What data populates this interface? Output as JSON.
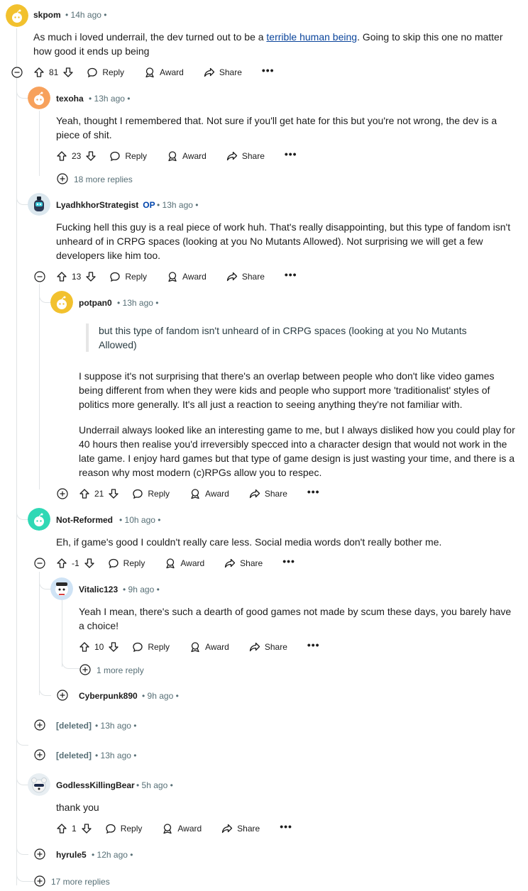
{
  "comments": [
    {
      "user": "skpom",
      "meta": "• 14h ago •",
      "text_before": "As much i loved underrail, the dev turned out to be a ",
      "link": "terrible human being",
      "text_after": ". Going to skip this one no matter how good it ends up being",
      "votes": "81"
    },
    {
      "user": "texoha",
      "meta": "• 13h ago •",
      "text": "Yeah, thought I remembered that. Not sure if you'll get hate for this but you're not wrong, the dev is a piece of shit.",
      "votes": "23",
      "more": "18 more replies"
    },
    {
      "user": "LyadhkhorStrategist",
      "op": "OP",
      "meta": "• 13h ago •",
      "text": "Fucking hell this guy is a real piece of work huh. That's really disappointing, but this type of fandom isn't unheard of in CRPG spaces (looking at you No Mutants Allowed). Not surprising we will get a few developers like him too.",
      "votes": "13"
    },
    {
      "user": "potpan0",
      "meta": "• 13h ago •",
      "quote": "but this type of fandom isn't unheard of in CRPG spaces (looking at you No Mutants Allowed)",
      "p1": "I suppose it's not surprising that there's an overlap between people who don't like video games being different from when they were kids and people who support more 'traditionalist' styles of politics more generally. It's all just a reaction to seeing anything they're not familiar with.",
      "p2": "Underrail always looked like an interesting game to me, but I always disliked how you could play for 40 hours then realise you'd irreversibly specced into a character design that would not work in the late game. I enjoy hard games but that type of game design is just wasting your time, and there is a reason why most modern (c)RPGs allow you to respec.",
      "votes": "21"
    },
    {
      "user": "Not-Reformed",
      "meta": "• 10h ago •",
      "text": "Eh, if game's good I couldn't really care less. Social media words don't really bother me.",
      "votes": "-1"
    },
    {
      "user": "Vitalic123",
      "meta": "• 9h ago •",
      "text": "Yeah I mean, there's such a dearth of good games not made by scum these days, you barely have a choice!",
      "votes": "10",
      "more": "1 more reply"
    },
    {
      "user": "Cyberpunk890",
      "meta": "• 9h ago •"
    },
    {
      "user": "[deleted]",
      "meta": "• 13h ago •"
    },
    {
      "user": "[deleted]",
      "meta": "• 13h ago •"
    },
    {
      "user": "GodlessKillingBear",
      "meta": "• 5h ago •",
      "text": "thank you",
      "votes": "1"
    },
    {
      "user": "hyrule5",
      "meta": "• 12h ago •"
    }
  ],
  "actions": {
    "reply": "Reply",
    "award": "Award",
    "share": "Share",
    "overflow": "•••"
  },
  "footer": {
    "more": "17 more replies"
  },
  "colors": {
    "snoo_yellow": "#f2c12e",
    "snoo_orange": "#f7a15c",
    "snoo_teal": "#2fd8b5",
    "meta_gray": "#576f76",
    "op_blue": "#0045ac",
    "link_blue": "#0a449b"
  },
  "icons": [
    "snoo-avatar",
    "upvote-icon",
    "downvote-icon",
    "reply-icon",
    "award-icon",
    "share-icon",
    "collapse-icon",
    "expand-icon",
    "overflow-icon"
  ]
}
